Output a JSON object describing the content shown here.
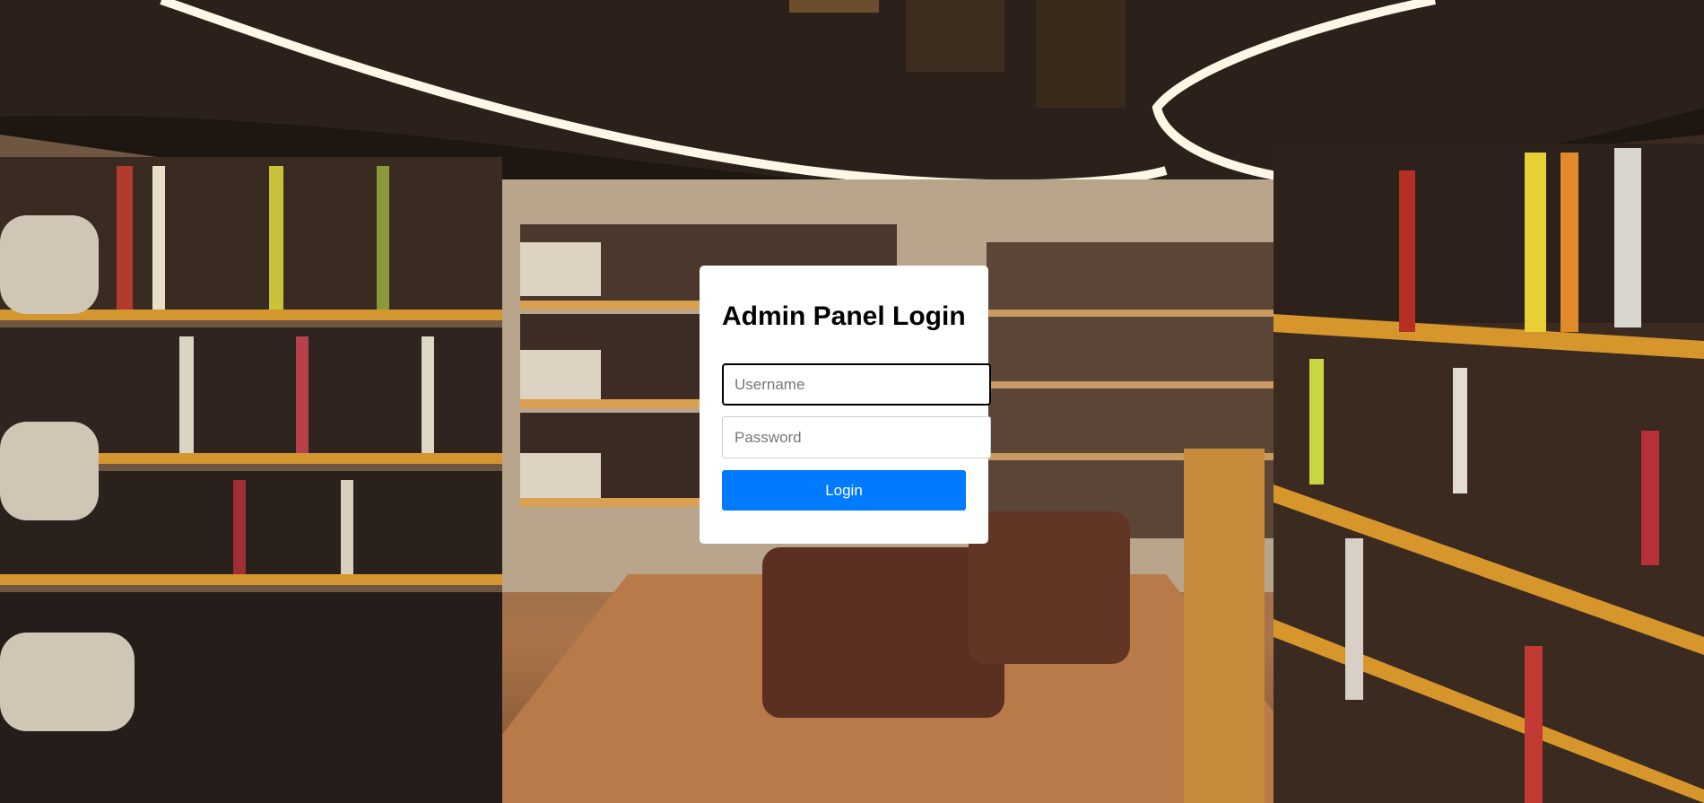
{
  "login": {
    "title": "Admin Panel Login",
    "username_placeholder": "Username",
    "password_placeholder": "Password",
    "submit_label": "Login"
  },
  "background": {
    "subject": "library bookshelves photo"
  },
  "colors": {
    "button": "#007bff",
    "card": "#ffffff"
  }
}
